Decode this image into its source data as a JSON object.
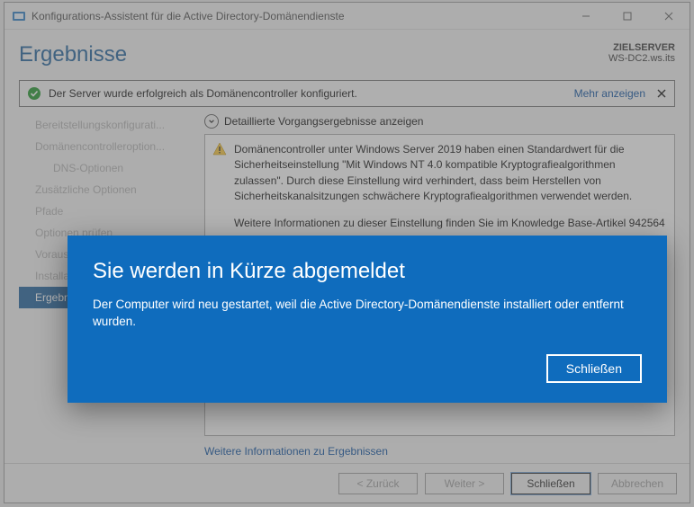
{
  "window": {
    "title": "Konfigurations-Assistent für die Active Directory-Domänendienste"
  },
  "header": {
    "page_title": "Ergebnisse",
    "target_label": "ZIELSERVER",
    "target_value": "WS-DC2.ws.its"
  },
  "notification": {
    "text": "Der Server wurde erfolgreich als Domänencontroller konfiguriert.",
    "more_link": "Mehr anzeigen"
  },
  "sidebar": {
    "items": [
      {
        "label": "Bereitstellungskonfigurati..."
      },
      {
        "label": "Domänencontrolleroption..."
      },
      {
        "label": "DNS-Optionen",
        "sub": true
      },
      {
        "label": "Zusätzliche Optionen"
      },
      {
        "label": "Pfade"
      },
      {
        "label": "Optionen prüfen"
      },
      {
        "label": "Voraussetzungsüberprüfu..."
      },
      {
        "label": "Installation"
      },
      {
        "label": "Ergebnisse",
        "active": true
      }
    ]
  },
  "details": {
    "header": "Detaillierte Vorgangsergebnisse anzeigen",
    "warning_para1": "Domänencontroller unter Windows Server 2019 haben einen Standardwert für die Sicherheitseinstellung \"Mit Windows NT 4.0 kompatible Kryptografiealgorithmen zulassen\". Durch diese Einstellung wird verhindert, dass beim Herstellen von Sicherheitskanalsitzungen schwächere Kryptografiealgorithmen verwendet werden.",
    "warning_para2": "Weitere Informationen zu dieser Einstellung finden Sie im Knowledge Base-Artikel 942564",
    "more_link": "Weitere Informationen zu Ergebnissen"
  },
  "buttons": {
    "back": "< Zurück",
    "next": "Weiter >",
    "close": "Schließen",
    "cancel": "Abbrechen"
  },
  "modal": {
    "title": "Sie werden in Kürze abgemeldet",
    "message": "Der Computer wird neu gestartet, weil die Active Directory-Domänendienste installiert oder entfernt wurden.",
    "close": "Schließen"
  }
}
